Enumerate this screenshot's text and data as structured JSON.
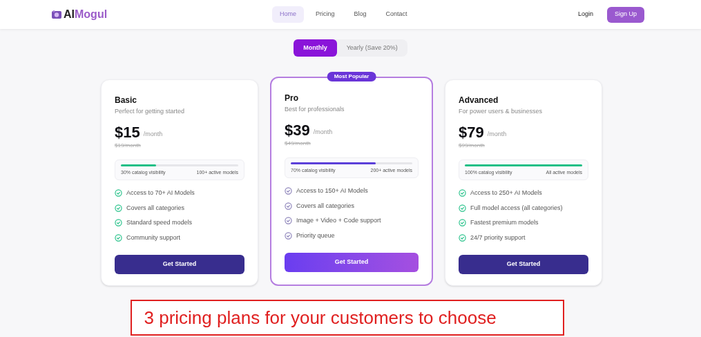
{
  "nav": {
    "logo": {
      "prefix": "AI",
      "suffix": "Mogul"
    },
    "links": [
      {
        "label": "Home",
        "selected": true
      },
      {
        "label": "Pricing",
        "selected": false
      },
      {
        "label": "Blog",
        "selected": false
      },
      {
        "label": "Contact",
        "selected": false
      }
    ],
    "login": "Login",
    "signup": "Sign Up"
  },
  "billing_toggle": [
    {
      "label": "Monthly",
      "selected": true
    },
    {
      "label": "Yearly (Save 20%)",
      "selected": false
    }
  ],
  "plans": [
    {
      "name": "Basic",
      "tagline": "Perfect for getting started",
      "price": "$15",
      "period": "/month",
      "old_price": "$19/month",
      "popular": false,
      "color": "#22c087",
      "level": 0.3,
      "visibility": "30% catalog visibility",
      "models": "100+ active models",
      "features": [
        "Access to 70+ AI Models",
        "Covers all categories",
        "Standard speed models",
        "Community support"
      ],
      "button": "Get Started"
    },
    {
      "name": "Pro",
      "tagline": "Best for professionals",
      "price": "$39",
      "period": "/month",
      "old_price": "$49/month",
      "popular": true,
      "badge": "Most Popular",
      "color": "#5b3fd9",
      "level": 0.7,
      "visibility": "70% catalog visibility",
      "models": "200+ active models",
      "features": [
        "Access to 150+ AI Models",
        "Covers all categories",
        "Image + Video + Code support",
        "Priority queue"
      ],
      "button": "Get Started"
    },
    {
      "name": "Advanced",
      "tagline": "For power users & businesses",
      "price": "$79",
      "period": "/month",
      "old_price": "$99/month",
      "popular": false,
      "color": "#22c087",
      "level": 1,
      "visibility": "100% catalog visibility",
      "models": "All active models",
      "features": [
        "Access to 250+ AI Models",
        "Full model access (all categories)",
        "Fastest premium models",
        "24/7 priority support"
      ],
      "button": "Get Started"
    }
  ],
  "caption": "3 pricing plans for your customers to choose"
}
